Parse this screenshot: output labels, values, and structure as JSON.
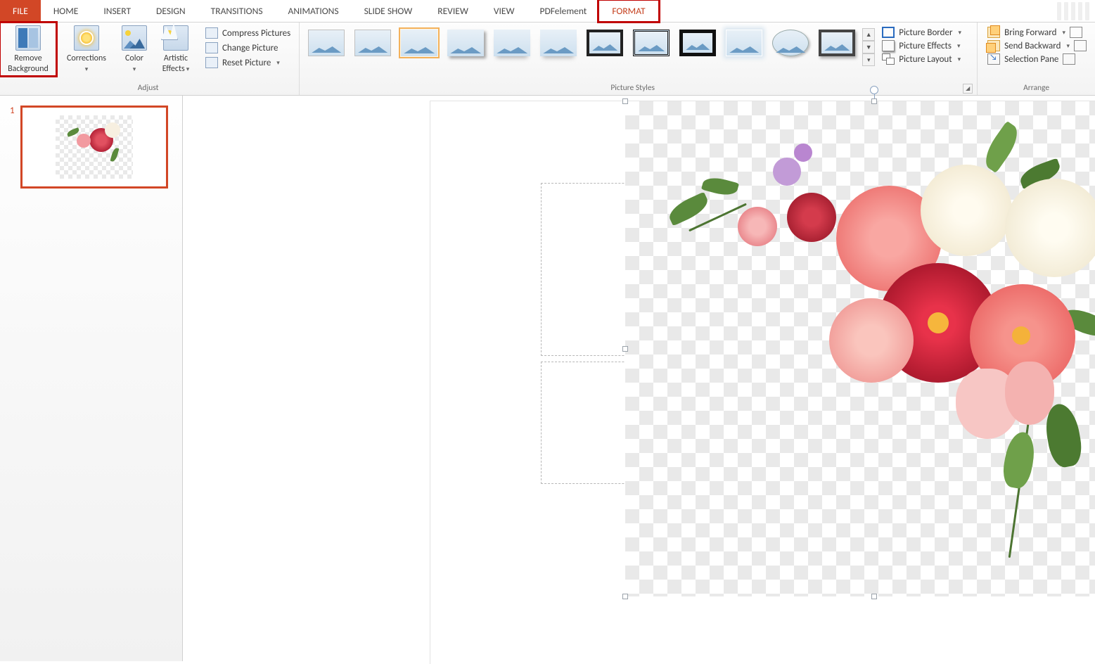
{
  "tabs": {
    "file": "FILE",
    "items": [
      "HOME",
      "INSERT",
      "DESIGN",
      "TRANSITIONS",
      "ANIMATIONS",
      "SLIDE SHOW",
      "REVIEW",
      "VIEW",
      "PDFelement",
      "FORMAT"
    ]
  },
  "ribbon": {
    "remove_bg": "Remove Background",
    "corrections": "Corrections",
    "color": "Color",
    "artistic": "Artistic Effects",
    "compress": "Compress Pictures",
    "change": "Change Picture",
    "reset": "Reset Picture",
    "adjust_label": "Adjust",
    "styles_label": "Picture Styles",
    "picture_border": "Picture Border",
    "picture_effects": "Picture Effects",
    "picture_layout": "Picture Layout",
    "bring_forward": "Bring Forward",
    "send_backward": "Send Backward",
    "selection_pane": "Selection Pane",
    "arrange_label": "Arrange"
  },
  "thumbs": {
    "slide1_num": "1"
  },
  "style_thumbs": [
    "plain",
    "plain",
    "selected",
    "shadow",
    "refl",
    "refl",
    "dark",
    "dbl",
    "dark2",
    "glow",
    "oval",
    "thick"
  ]
}
